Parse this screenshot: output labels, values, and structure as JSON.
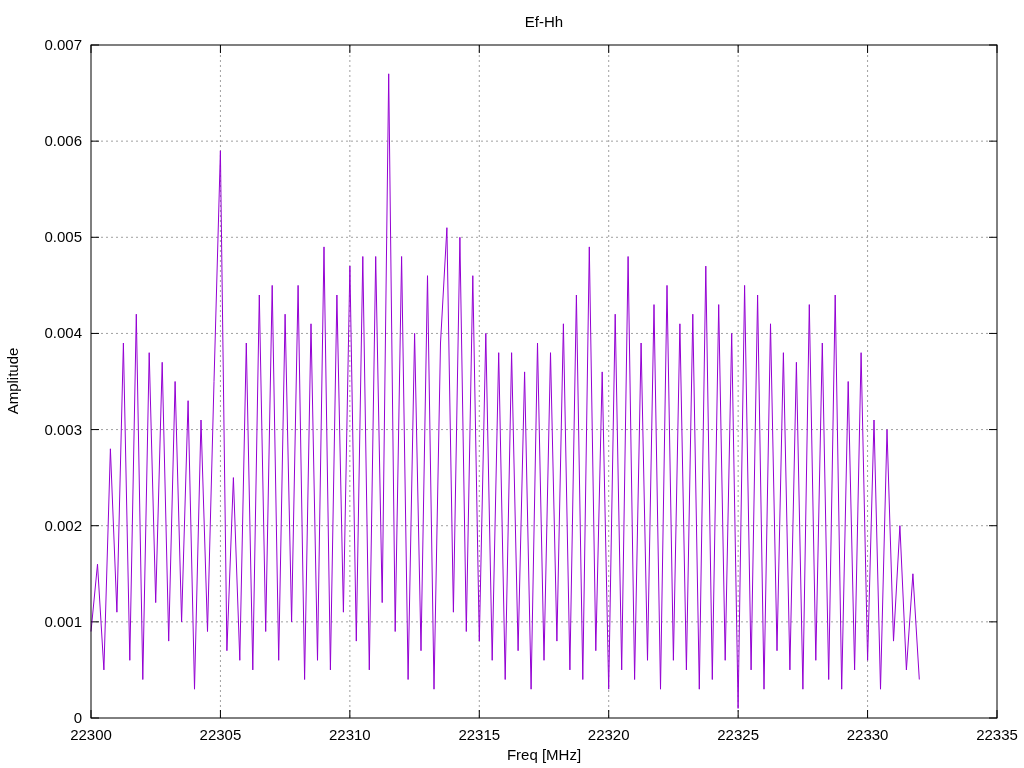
{
  "chart_data": {
    "type": "line",
    "title": "Ef-Hh",
    "xlabel": "Freq [MHz]",
    "ylabel": "Amplitude",
    "xlim": [
      22300,
      22335
    ],
    "ylim": [
      0,
      0.007
    ],
    "grid": true,
    "xticks": [
      22300,
      22305,
      22310,
      22315,
      22320,
      22325,
      22330,
      22335
    ],
    "yticks": [
      0,
      0.001,
      0.002,
      0.003,
      0.004,
      0.005,
      0.006,
      0.007
    ],
    "x": [
      22300,
      22300.25,
      22300.5,
      22300.75,
      22301,
      22301.25,
      22301.5,
      22301.75,
      22302,
      22302.25,
      22302.5,
      22302.75,
      22303,
      22303.25,
      22303.5,
      22303.75,
      22304,
      22304.25,
      22304.5,
      22304.75,
      22305,
      22305.25,
      22305.5,
      22305.75,
      22306,
      22306.25,
      22306.5,
      22306.75,
      22307,
      22307.25,
      22307.5,
      22307.75,
      22308,
      22308.25,
      22308.5,
      22308.75,
      22309,
      22309.25,
      22309.5,
      22309.75,
      22310,
      22310.25,
      22310.5,
      22310.75,
      22311,
      22311.25,
      22311.5,
      22311.75,
      22312,
      22312.25,
      22312.5,
      22312.75,
      22313,
      22313.25,
      22313.5,
      22313.75,
      22314,
      22314.25,
      22314.5,
      22314.75,
      22315,
      22315.25,
      22315.5,
      22315.75,
      22316,
      22316.25,
      22316.5,
      22316.75,
      22317,
      22317.25,
      22317.5,
      22317.75,
      22318,
      22318.25,
      22318.5,
      22318.75,
      22319,
      22319.25,
      22319.5,
      22319.75,
      22320,
      22320.25,
      22320.5,
      22320.75,
      22321,
      22321.25,
      22321.5,
      22321.75,
      22322,
      22322.25,
      22322.5,
      22322.75,
      22323,
      22323.25,
      22323.5,
      22323.75,
      22324,
      22324.25,
      22324.5,
      22324.75,
      22325,
      22325.25,
      22325.5,
      22325.75,
      22326,
      22326.25,
      22326.5,
      22326.75,
      22327,
      22327.25,
      22327.5,
      22327.75,
      22328,
      22328.25,
      22328.5,
      22328.75,
      22329,
      22329.25,
      22329.5,
      22329.75,
      22330,
      22330.25,
      22330.5,
      22330.75,
      22331,
      22331.25,
      22331.5,
      22331.75,
      22332
    ],
    "series": [
      {
        "color": "#9400d3",
        "values": [
          0.0009,
          0.0016,
          0.0005,
          0.0028,
          0.0011,
          0.0039,
          0.0006,
          0.0042,
          0.0004,
          0.0038,
          0.0012,
          0.0037,
          0.0008,
          0.0035,
          0.001,
          0.0033,
          0.0003,
          0.0031,
          0.0009,
          0.0035,
          0.0059,
          0.0007,
          0.0025,
          0.0006,
          0.0039,
          0.0005,
          0.0044,
          0.0009,
          0.0045,
          0.0006,
          0.0042,
          0.001,
          0.0045,
          0.0004,
          0.0041,
          0.0006,
          0.0049,
          0.0005,
          0.0044,
          0.0011,
          0.0047,
          0.0008,
          0.0048,
          0.0005,
          0.0048,
          0.0012,
          0.0067,
          0.0009,
          0.0048,
          0.0004,
          0.004,
          0.0007,
          0.0046,
          0.0003,
          0.0039,
          0.0051,
          0.0011,
          0.005,
          0.0009,
          0.0046,
          0.0008,
          0.004,
          0.0006,
          0.0038,
          0.0004,
          0.0038,
          0.0007,
          0.0036,
          0.0003,
          0.0039,
          0.0006,
          0.0038,
          0.0008,
          0.0041,
          0.0005,
          0.0044,
          0.0004,
          0.0049,
          0.0007,
          0.0036,
          0.0003,
          0.0042,
          0.0005,
          0.0048,
          0.0004,
          0.0039,
          0.0006,
          0.0043,
          0.0003,
          0.0045,
          0.0006,
          0.0041,
          0.0005,
          0.0042,
          0.0003,
          0.0047,
          0.0004,
          0.0043,
          0.0006,
          0.004,
          0.0001,
          0.0045,
          0.0005,
          0.0044,
          0.0003,
          0.0041,
          0.0007,
          0.0038,
          0.0005,
          0.0037,
          0.0003,
          0.0043,
          0.0006,
          0.0039,
          0.0004,
          0.0044,
          0.0003,
          0.0035,
          0.0005,
          0.0038,
          0.0006,
          0.0031,
          0.0003,
          0.003,
          0.0008,
          0.002,
          0.0005,
          0.0015,
          0.0004
        ]
      }
    ]
  }
}
